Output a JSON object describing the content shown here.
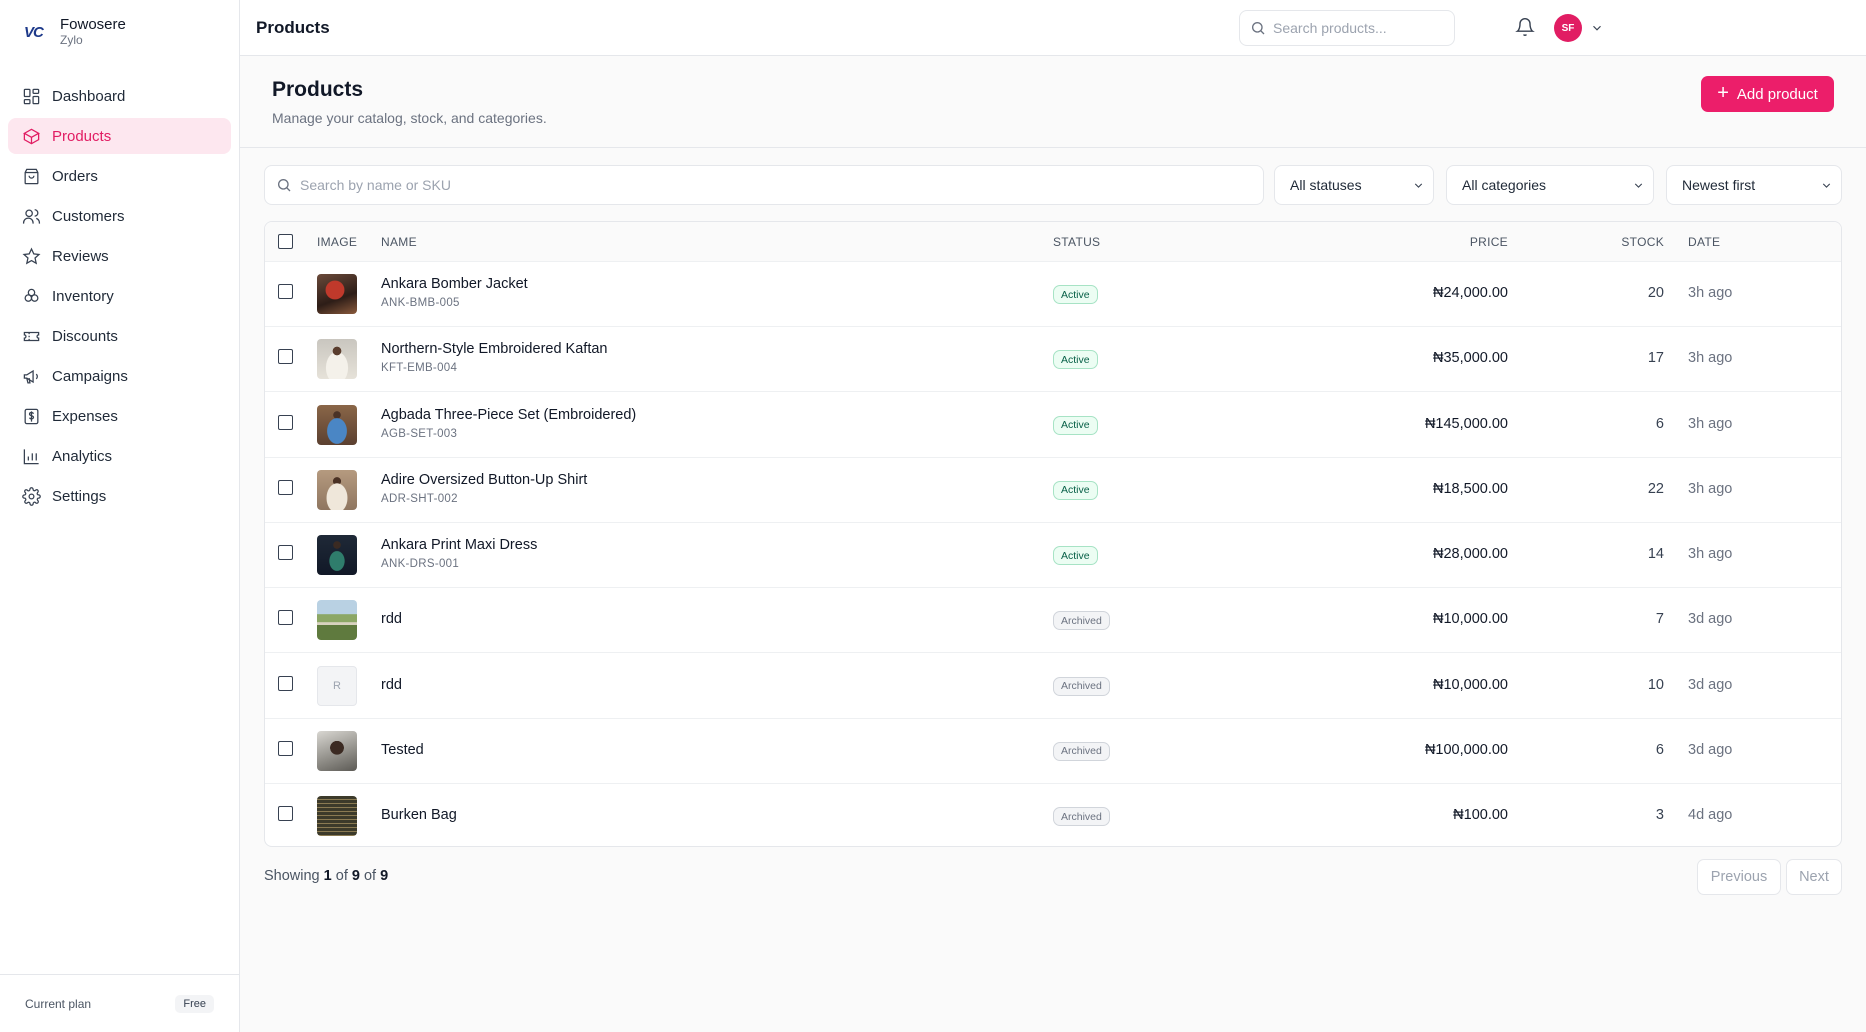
{
  "brand": {
    "logo": "VC",
    "name": "Fowosere",
    "sub": "Zylo"
  },
  "nav": [
    {
      "label": "Dashboard",
      "icon": "dashboard-icon",
      "active": false
    },
    {
      "label": "Products",
      "icon": "box-icon",
      "active": true
    },
    {
      "label": "Orders",
      "icon": "shopping-bag-icon",
      "active": false
    },
    {
      "label": "Customers",
      "icon": "users-icon",
      "active": false
    },
    {
      "label": "Reviews",
      "icon": "star-icon",
      "active": false
    },
    {
      "label": "Inventory",
      "icon": "boxes-icon",
      "active": false
    },
    {
      "label": "Discounts",
      "icon": "ticket-icon",
      "active": false
    },
    {
      "label": "Campaigns",
      "icon": "megaphone-icon",
      "active": false
    },
    {
      "label": "Expenses",
      "icon": "receipt-icon",
      "active": false
    },
    {
      "label": "Analytics",
      "icon": "bar-chart-icon",
      "active": false
    },
    {
      "label": "Settings",
      "icon": "gear-icon",
      "active": false
    }
  ],
  "plan": {
    "label": "Current plan",
    "badge": "Free"
  },
  "topbar": {
    "title": "Products",
    "search_placeholder": "Search products...",
    "avatar_initials": "SF"
  },
  "page": {
    "title": "Products",
    "subtitle": "Manage your catalog, stock, and categories.",
    "add_label": "Add product"
  },
  "filters": {
    "search_placeholder": "Search by name or SKU",
    "status": "All statuses",
    "category": "All categories",
    "sort": "Newest first"
  },
  "table": {
    "headers": {
      "image": "IMAGE",
      "name": "NAME",
      "status": "STATUS",
      "price": "PRICE",
      "stock": "STOCK",
      "date": "DATE"
    },
    "rows": [
      {
        "name": "Ankara Bomber Jacket",
        "sku": "ANK-BMB-005",
        "status": "Active",
        "price": "₦24,000.00",
        "stock": "20",
        "date": "3h ago",
        "thumb": "photo-red"
      },
      {
        "name": "Northern-Style Embroidered Kaftan",
        "sku": "KFT-EMB-004",
        "status": "Active",
        "price": "₦35,000.00",
        "stock": "17",
        "date": "3h ago",
        "thumb": "photo-white"
      },
      {
        "name": "Agbada Three-Piece Set (Embroidered)",
        "sku": "AGB-SET-003",
        "status": "Active",
        "price": "₦145,000.00",
        "stock": "6",
        "date": "3h ago",
        "thumb": "photo-blue"
      },
      {
        "name": "Adire Oversized Button-Up Shirt",
        "sku": "ADR-SHT-002",
        "status": "Active",
        "price": "₦18,500.00",
        "stock": "22",
        "date": "3h ago",
        "thumb": "photo-beige"
      },
      {
        "name": "Ankara Print Maxi Dress",
        "sku": "ANK-DRS-001",
        "status": "Active",
        "price": "₦28,000.00",
        "stock": "14",
        "date": "3h ago",
        "thumb": "photo-dark"
      },
      {
        "name": "rdd",
        "sku": "",
        "status": "Archived",
        "price": "₦10,000.00",
        "stock": "7",
        "date": "3d ago",
        "thumb": "photo-landscape"
      },
      {
        "name": "rdd",
        "sku": "",
        "status": "Archived",
        "price": "₦10,000.00",
        "stock": "10",
        "date": "3d ago",
        "thumb": "placeholder",
        "placeholder_letter": "R"
      },
      {
        "name": "Tested",
        "sku": "",
        "status": "Archived",
        "price": "₦100,000.00",
        "stock": "6",
        "date": "3d ago",
        "thumb": "photo-portrait"
      },
      {
        "name": "Burken Bag",
        "sku": "",
        "status": "Archived",
        "price": "₦100.00",
        "stock": "3",
        "date": "4d ago",
        "thumb": "photo-screen"
      }
    ]
  },
  "pagination": {
    "showing_prefix": "Showing ",
    "from": "1",
    "of1": " of ",
    "to": "9",
    "of2": " of ",
    "total": "9",
    "prev_label": "Previous",
    "next_label": "Next"
  },
  "colors": {
    "accent": "#ec1e6a",
    "active_badge": "#ecfdf3",
    "archived_badge": "#f3f4f6"
  }
}
